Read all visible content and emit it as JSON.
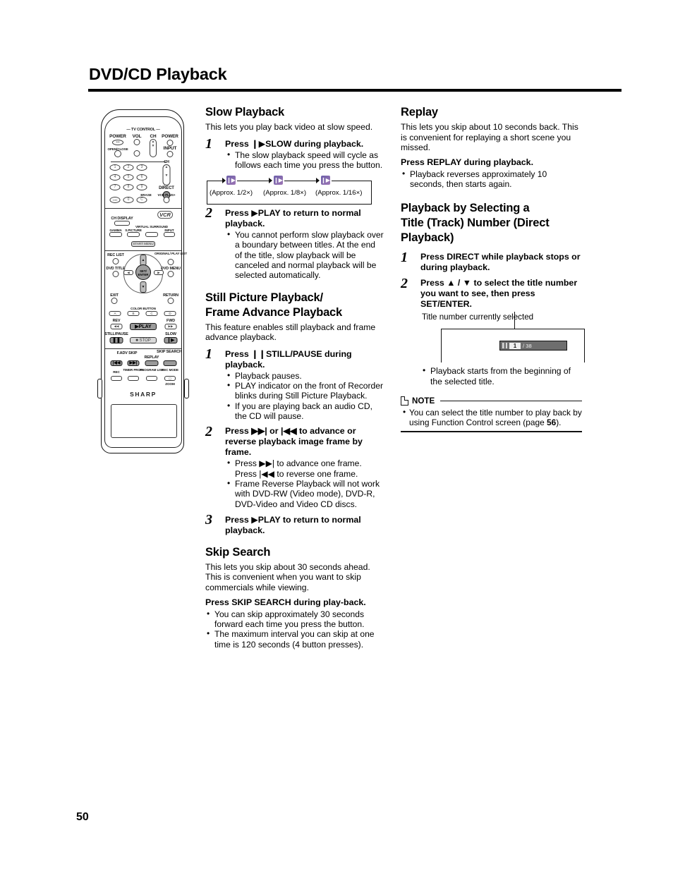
{
  "header": {
    "title": "DVD/CD Playback"
  },
  "footer": {
    "page_number": "50"
  },
  "remote": {
    "label_tv_control": "— TV CONTROL —",
    "label_power": "POWER",
    "label_vol": "VOL",
    "label_ch": "CH",
    "label_power2": "POWER",
    "label_open_close": "OPEN/CLOSE",
    "label_input": "INPUT",
    "label_ch2": "CH",
    "label_direct": "DIRECT",
    "label_erase": "ERASE",
    "label_vcrplus": "VCR PLUS+",
    "num_1": "1",
    "num_2": "2",
    "num_3": "3",
    "num_4": "4",
    "num_5": "5",
    "num_6": "6",
    "num_7": "7",
    "num_8": "8",
    "num_9": "9",
    "num_100": "100",
    "num_0": "0",
    "num_c": "C",
    "label_ch_display": "CH DISPLAY",
    "label_vcr_logo": "VCR",
    "label_gamma": "GAMMA",
    "label_s_picture": "S.PICTURE",
    "label_virtual_surround": "VIRTUAL SURROUND",
    "label_input2": "INPUT",
    "label_start_menu": "START MENU",
    "label_rec_list": "REC LIST",
    "label_original_play_list": "ORIGINAL/ PLAY LIST",
    "label_dvd_title": "DVD TITLE",
    "label_dvd_menu": "DVD MENU",
    "label_set_enter": "SET/ ENTER",
    "label_exit": "EXIT",
    "label_return": "RETURN",
    "label_color_button": "COLOR BUTTON",
    "color_a": "A",
    "color_b": "B",
    "color_c": "C",
    "color_d": "D",
    "label_rev": "REV",
    "label_fwd": "FWD",
    "label_play": "PLAY",
    "label_still_pause": "STILL/PAUSE",
    "label_stop": "STOP",
    "label_slow": "SLOW",
    "label_ready_skip": "F.ADV SKIP",
    "label_replay": "REPLAY",
    "label_skip_search": "SKIP SEARCH",
    "label_rec": "REC",
    "label_timer_prog": "TIMER PROG.",
    "label_program_list": "PROGRAM LIST",
    "label_rec_mode": "REC MODE",
    "label_zoom": "ZOOM",
    "brand": "SHARP"
  },
  "left_column": {
    "slow_playback": {
      "heading": "Slow Playback",
      "intro": "This lets you play back video at slow speed.",
      "step1": {
        "num": "1",
        "head_pre": "Press ",
        "head_key": "SLOW",
        "head_post": " during playback.",
        "bullets": [
          "The slow playback speed will cycle as follows each time you press the button."
        ]
      },
      "cycle": {
        "speeds": [
          "(Approx. 1/2×)",
          "(Approx. 1/8×)",
          "(Approx. 1/16×)"
        ],
        "speed_nums": [
          "1",
          "2",
          "1",
          "8",
          "1",
          "16"
        ]
      },
      "step2": {
        "num": "2",
        "head_pre": "Press ",
        "head_key": "PLAY",
        "head_post": " to return to normal playback.",
        "bullets": [
          "You cannot perform slow playback over a boundary between titles.  At the end of the title, slow playback will be canceled and normal playback will be selected automatically."
        ]
      }
    },
    "still_picture": {
      "heading_line1": "Still Picture Playback/",
      "heading_line2": "Frame Advance Playback",
      "intro": "This feature enables still playback and frame advance playback.",
      "step1": {
        "num": "1",
        "head_pre": "Press ",
        "head_key": "STILL/PAUSE",
        "head_post": " during playback.",
        "bullets": [
          "Playback pauses.",
          "PLAY indicator on the front of Recorder blinks during Still Picture Playback.",
          "If you are playing back an audio CD, the CD will pause."
        ]
      },
      "step2": {
        "num": "2",
        "head_text": "Press ▶▶| or |◀◀ to advance or reverse playback image frame by frame.",
        "bullets": [
          "Press ▶▶| to advance one frame. Press |◀◀ to reverse one frame.",
          "Frame Reverse Playback will not work with DVD-RW (Video mode), DVD-R, DVD-Video and Video CD discs."
        ]
      },
      "step3": {
        "num": "3",
        "head_pre": "Press ",
        "head_key": "PLAY",
        "head_post": " to return to normal playback."
      }
    },
    "skip_search": {
      "heading": "Skip Search",
      "intro": "This lets you skip about 30 seconds ahead. This is convenient when you want to skip commercials while viewing.",
      "press_pre": "Press ",
      "press_key": "SKIP SEARCH",
      "press_post": " during play-back.",
      "bullets": [
        "You can skip approximately 30 seconds forward each time you press the button.",
        "The maximum interval you can skip at one time is 120 seconds (4 button presses)."
      ]
    }
  },
  "right_column": {
    "replay": {
      "heading": "Replay",
      "intro": "This lets you skip about 10 seconds back. This is convenient for replaying a short scene you missed.",
      "press_pre": "Press ",
      "press_key": "REPLAY",
      "press_post": " during playback.",
      "bullets": [
        "Playback reverses approximately 10 seconds, then starts again."
      ]
    },
    "direct_playback": {
      "heading_line1": "Playback by Selecting a",
      "heading_line2": "Title (Track) Number (Direct",
      "heading_line3": "Playback)",
      "step1": {
        "num": "1",
        "head_pre": "Press ",
        "head_key": "DIRECT",
        "head_post": " while playback stops or during playback."
      },
      "step2": {
        "num": "2",
        "head_pre": "Press ▲ / ▼ to select the title number you want to see, then press ",
        "head_key": "SET/ENTER",
        "head_post": ".",
        "caption": "Title number currently selected",
        "osd": {
          "current_title": "1",
          "total_titles": "/ 38"
        },
        "bullets": [
          "Playback starts from the beginning of the selected title."
        ]
      }
    },
    "note": {
      "label": "NOTE",
      "bullets": [
        "You can select the title number to play back by using Function Control screen (page 56)."
      ],
      "bullet_text_pre": "You can select the title number to play back by using Function Control screen (page ",
      "bullet_page_ref": "56",
      "bullet_text_post": ")."
    }
  }
}
